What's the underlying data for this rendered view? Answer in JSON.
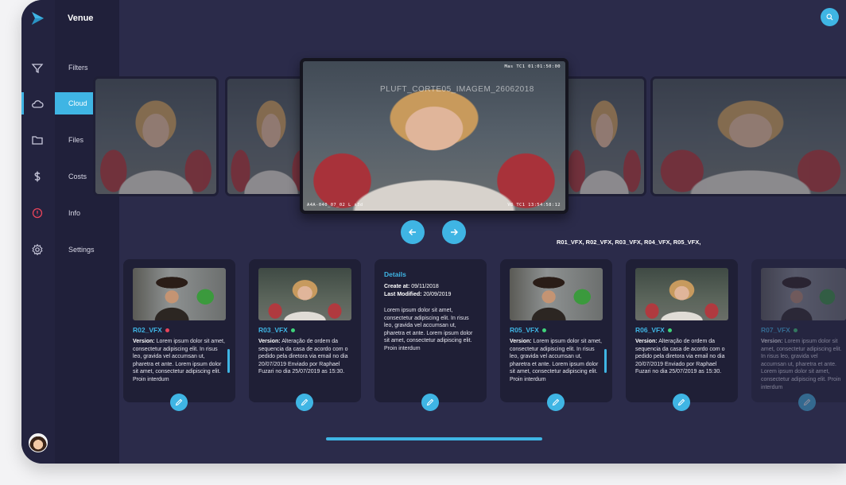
{
  "app": {
    "title": "Venue"
  },
  "nav": {
    "items": [
      {
        "label": "Filters",
        "icon": "filter-icon"
      },
      {
        "label": "Cloud",
        "icon": "cloud-icon",
        "active": true
      },
      {
        "label": "Files",
        "icon": "folder-icon"
      },
      {
        "label": "Costs",
        "icon": "dollar-icon"
      },
      {
        "label": "Info",
        "icon": "info-icon"
      },
      {
        "label": "Settings",
        "icon": "gear-icon"
      }
    ]
  },
  "carousel": {
    "featured": {
      "watermark": "PLUFT_CORTE05_IMAGEM_26062018",
      "tc_top_right": "Mas TC1  01:01:50:00",
      "tc_bottom_left": "A4A-040_07_02 L s3d",
      "tc_bottom_right": "V8 TC1   13:54:58:12"
    }
  },
  "tags": "R01_VFX, R02_VFX, R03_VFX, R04_VFX, R05_VFX,",
  "cards": [
    {
      "title": "R02_VFX",
      "status_color": "#e8445a",
      "version_label": "Version:",
      "text": "Lorem ipsum dolor sit amet, consectetur adipiscing elit. In risus leo, gravida vel accumsan ut, pharetra et ante. Lorem ipsum dolor sit amet, consectetur adipiscing elit. Proin interdum"
    },
    {
      "title": "R03_VFX",
      "status_color": "#3ed37a",
      "version_label": "Version:",
      "text": "Alteração de ordem da sequencia da casa de acordo com o pedido pela diretora via email no dia 20/07/2019 Enviado por Raphael Fuzari no dia 25/07/2019 as 15:30."
    },
    {
      "details_title": "Details",
      "create_label": "Create at:",
      "create_value": "09/11/2018",
      "modified_label": "Last Modified:",
      "modified_value": "20/09/2019",
      "text": "Lorem ipsum dolor sit amet, consectetur adipiscing elit. In risus leo, gravida vel accumsan ut, pharetra et ante. Lorem ipsum dolor sit amet, consectetur adipiscing elit. Proin interdum"
    },
    {
      "title": "R05_VFX",
      "status_color": "#3ed37a",
      "version_label": "Version:",
      "text": "Lorem ipsum dolor sit amet, consectetur adipiscing elit. In risus leo, gravida vel accumsan ut, pharetra et ante. Lorem ipsum dolor sit amet, consectetur adipiscing elit. Proin interdum"
    },
    {
      "title": "R06_VFX",
      "status_color": "#3ed37a",
      "version_label": "Version:",
      "text": "Alteração de ordem da sequencia da casa de acordo com o pedido pela diretora via email no dia 20/07/2019 Enviado por Raphael Fuzari no dia 25/07/2019 as 15:30."
    },
    {
      "title": "R07_VFX",
      "status_color": "#3ed37a",
      "version_label": "Version:",
      "text": "Lorem ipsum dolor sit amet, consectetur adipiscing elit. In risus leo, gravida vel accumsan ut, pharetra et ante. Lorem ipsum dolor sit amet, consectetur adipiscing elit. Proin interdum"
    }
  ],
  "colors": {
    "accent": "#3fb5e4",
    "background": "#2b2b4a",
    "card": "#1f1f36"
  }
}
